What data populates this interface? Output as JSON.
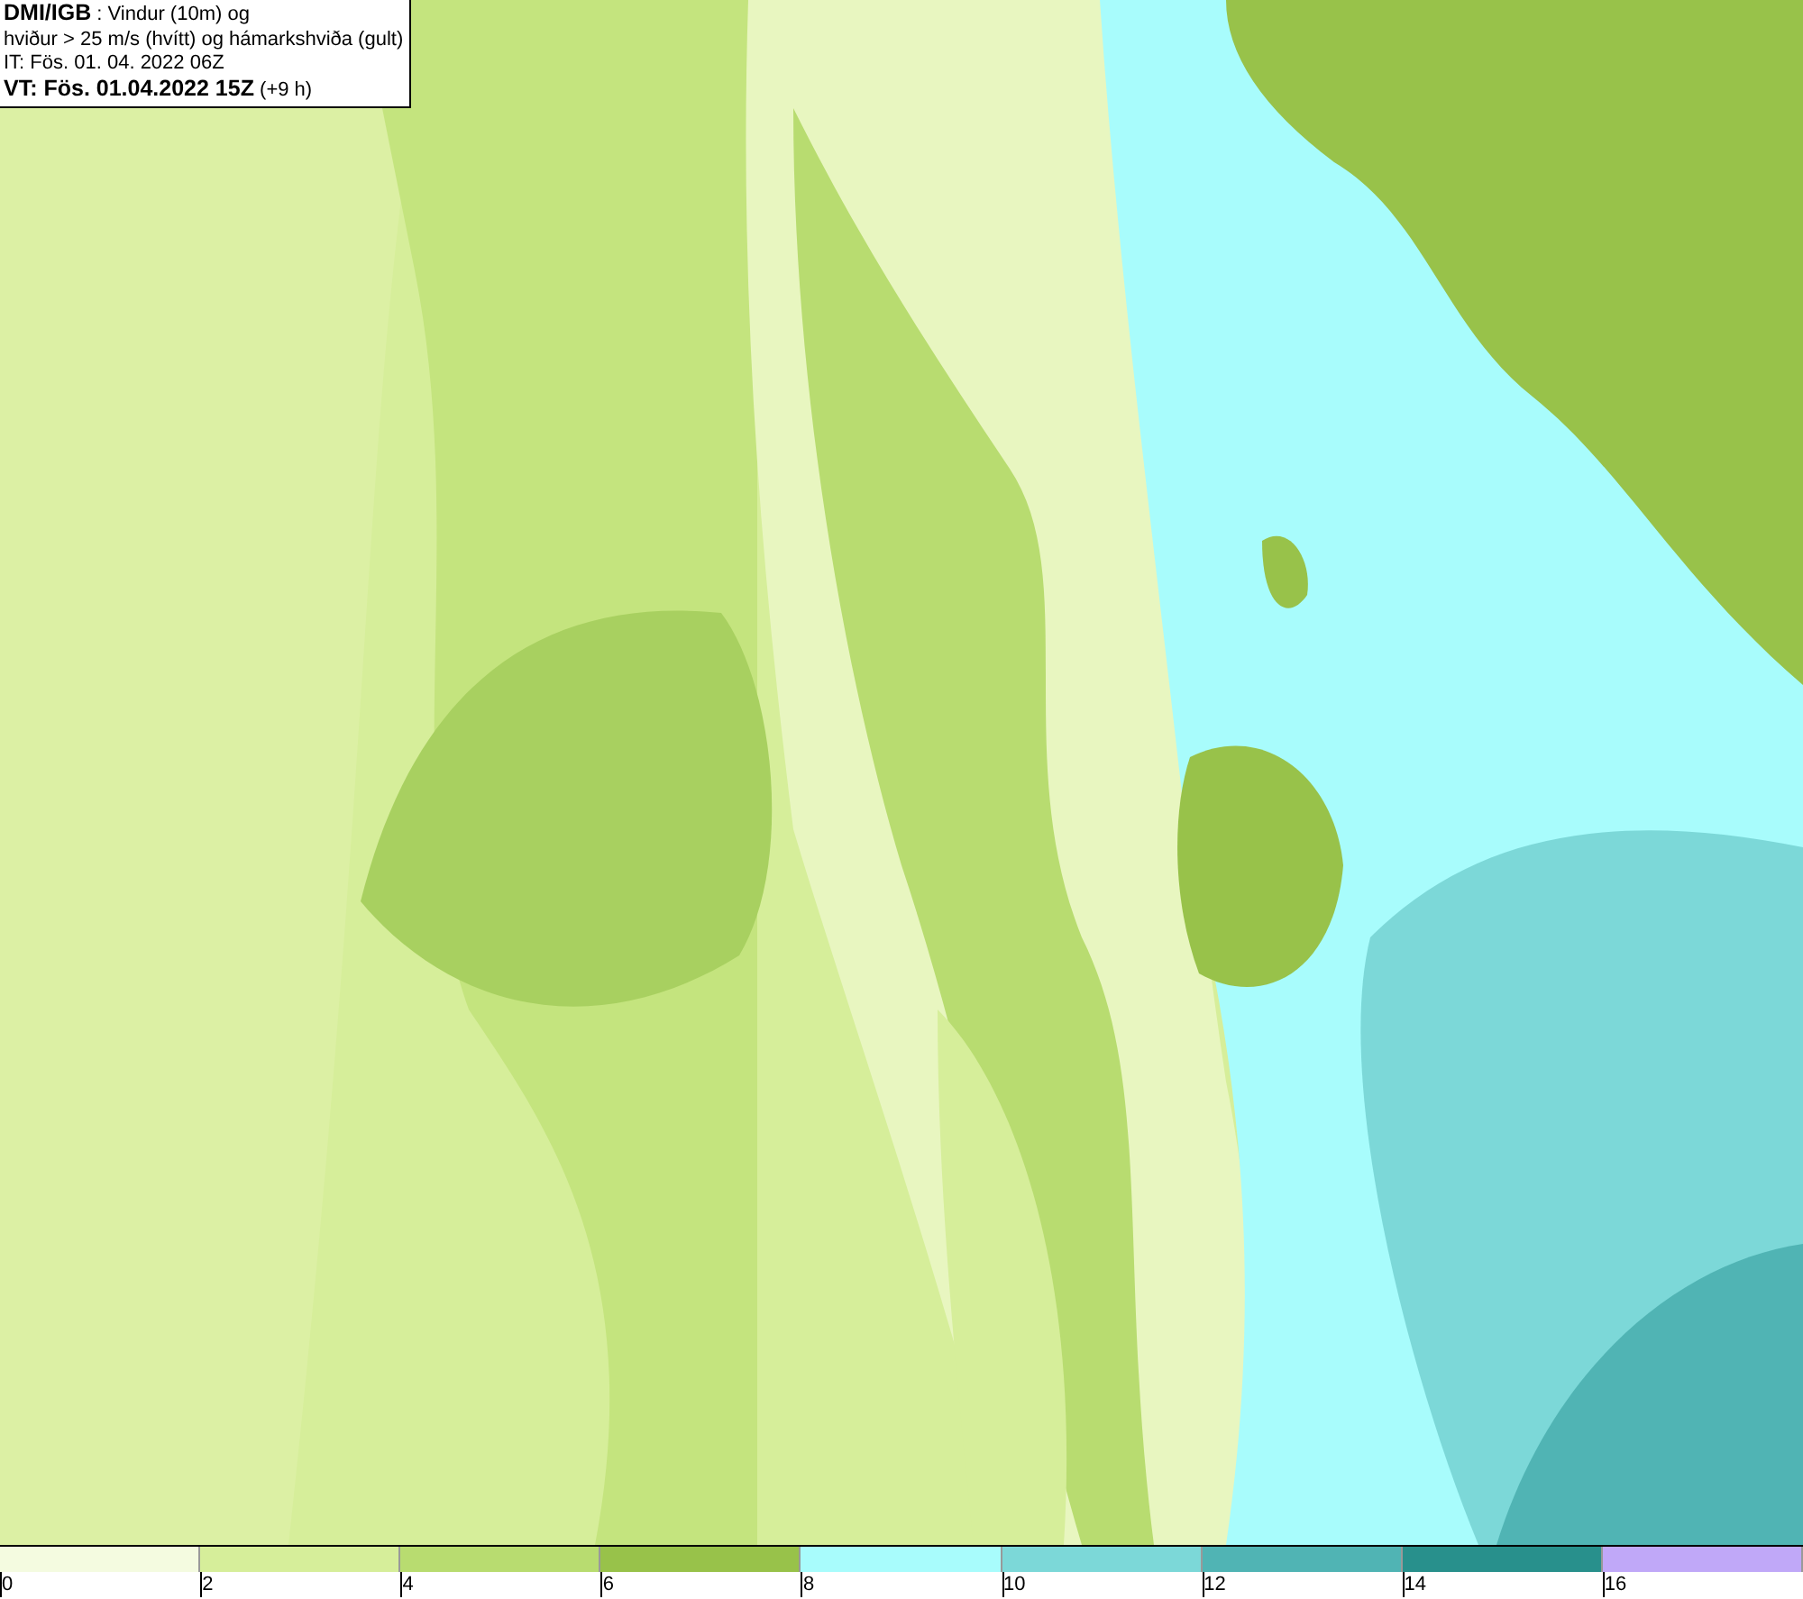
{
  "title_box": {
    "lines": [
      "**DMI/IGB** : Vindur (10m) og",
      "hviður > 25 m/s (hvítt) og hámarkshviða (gult)",
      "IT: Fös. 01. 04. 2022 06Z",
      "**VT: Fös. 01.04.2022 15Z** (+9 h)"
    ]
  },
  "legend": [
    {
      "label": "0",
      "color": "#f4fbe0"
    },
    {
      "label": "2",
      "color": "#d6ee9a"
    },
    {
      "label": "4",
      "color": "#b8dc70"
    },
    {
      "label": "6",
      "color": "#98c24a"
    },
    {
      "label": "8",
      "color": "#a8fcfc"
    },
    {
      "label": "10",
      "color": "#7cd8d8"
    },
    {
      "label": "12",
      "color": "#50b4b4"
    },
    {
      "label": "14",
      "color": "#28908c"
    },
    {
      "label": "16",
      "color": "#c0a8f8"
    }
  ]
}
